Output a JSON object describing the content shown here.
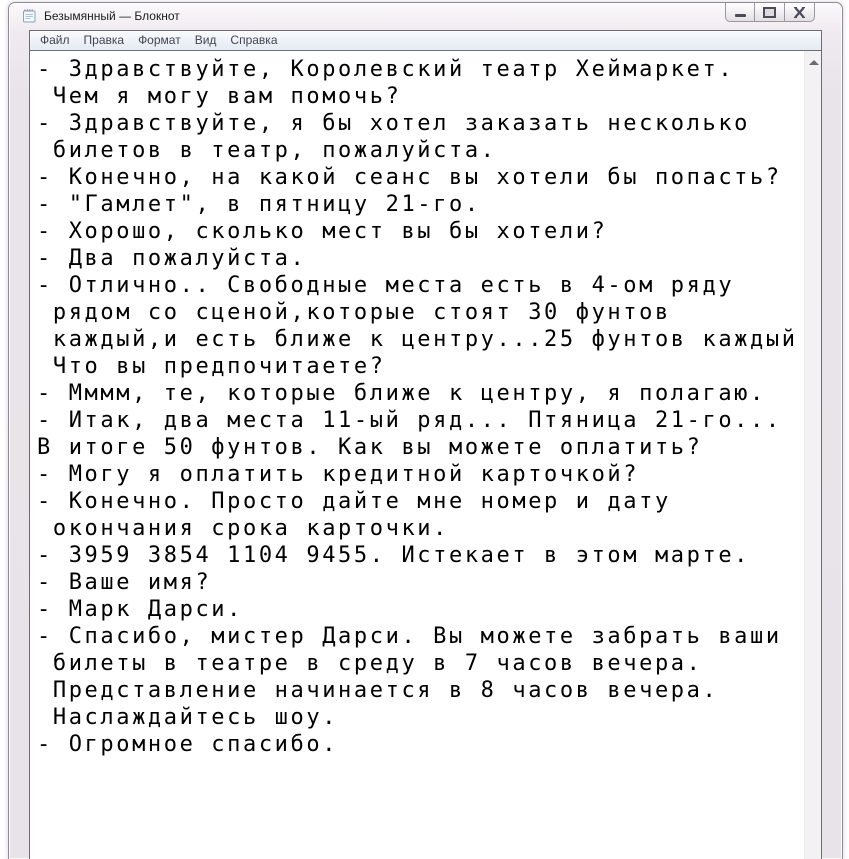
{
  "window": {
    "title": "Безымянный — Блокнот",
    "icon": "notepad-icon",
    "controls": [
      {
        "name": "minimize-button",
        "icon": "minimize-icon"
      },
      {
        "name": "maximize-button",
        "icon": "maximize-icon"
      },
      {
        "name": "close-button",
        "icon": "close-icon",
        "glyph": "✕"
      }
    ]
  },
  "menu_bar": {
    "items": [
      {
        "label": "Файл"
      },
      {
        "label": "Правка"
      },
      {
        "label": "Формат"
      },
      {
        "label": "Вид"
      },
      {
        "label": "Справка"
      }
    ]
  },
  "editor": {
    "lines": [
      "- Здравствуйте, Королевский театр Хеймаркет.",
      " Чем я могу вам помочь?",
      "- Здравствуйте, я бы хотел заказать несколько",
      " билетов в театр, пожалуйста.",
      "- Конечно, на какой сеанс вы хотели бы попасть?",
      "- \"Гамлет\", в пятницу 21-го.",
      "- Хорошо, сколько мест вы бы хотели?",
      "- Два пожалуйста.",
      "- Отлично.. Свободные места есть в 4-ом ряду",
      " рядом со сценой,которые стоят 30 фунтов",
      " каждый,и есть ближе к центру...25 фунтов каждый",
      " Что вы предпочитаете?",
      "- Мммм, те, которые ближе к центру, я полагаю.",
      "- Итак, два места 11-ый ряд... Птяница 21-го...",
      "В итоге 50 фунтов. Как вы можете оплатить?",
      "- Могу я оплатить кредитной карточкой?",
      "- Конечно. Просто дайте мне номер и дату",
      " окончания срока карточки.",
      "- 3959 3854 1104 9455. Истекает в этом марте.",
      "- Ваше имя?",
      "- Марк Дарси.",
      "- Спасибо, мистер Дарси. Вы можете забрать ваши",
      " билеты в театре в среду в 7 часов вечера.",
      " Представление начинается в 8 часов вечера.",
      " Наслаждайтесь шоу.",
      "- Огромное спасибо."
    ]
  },
  "colors": {
    "glass": "#e9e4e9",
    "client_border": "#6e6b76",
    "menu_gradient_top": "#f9fbfe",
    "menu_gradient_bottom": "#e5ebf3",
    "text": "#000000",
    "scrollbar_track": "#f4f1f4"
  }
}
